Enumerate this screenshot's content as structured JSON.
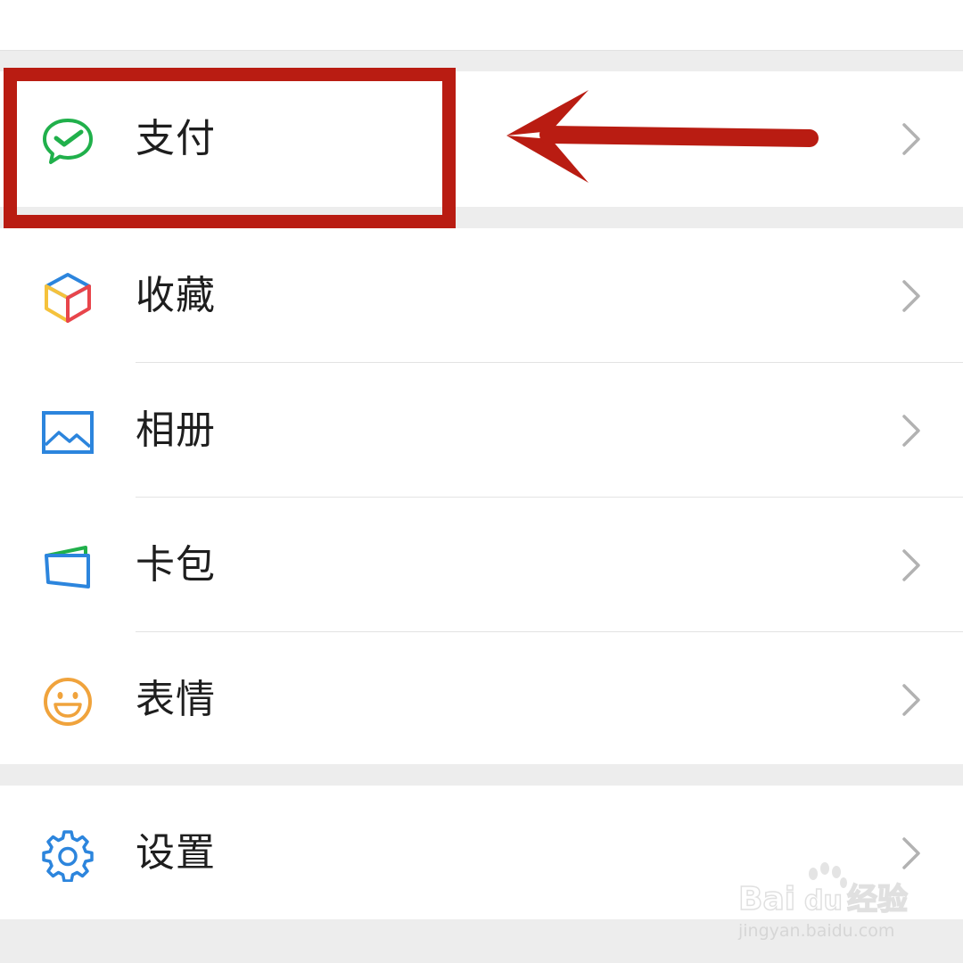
{
  "menu": {
    "pay": {
      "label": "支付",
      "icon": "wechat-pay-icon"
    },
    "items": [
      {
        "label": "收藏",
        "icon": "favorites-cube-icon"
      },
      {
        "label": "相册",
        "icon": "album-image-icon"
      },
      {
        "label": "卡包",
        "icon": "card-wallet-icon"
      },
      {
        "label": "表情",
        "icon": "emoji-smile-icon"
      }
    ],
    "settings": {
      "label": "设置",
      "icon": "gear-icon"
    }
  },
  "annotation": {
    "highlight_color": "#b91c12"
  },
  "watermark": {
    "brand": "Bai",
    "brand_suffix": "du",
    "product": "经验",
    "url": "jingyan.baidu.com"
  },
  "colors": {
    "background": "#ededed",
    "card": "#ffffff",
    "wechat_green": "#20b04b",
    "icon_blue": "#2c85dd",
    "chevron": "#b2b2b2"
  }
}
